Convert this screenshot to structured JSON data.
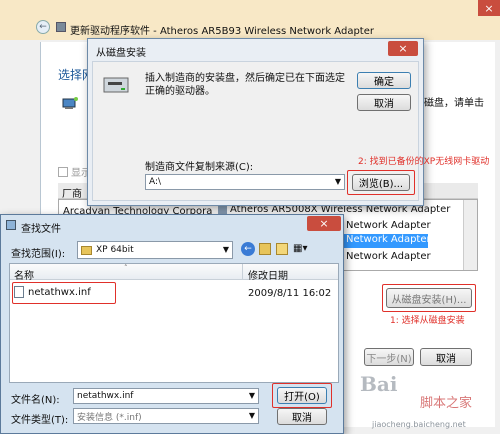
{
  "back_window": {
    "title": "更新驱动程序软件 - Atheros AR5B93 Wireless Network Adapter",
    "heading": "选择网",
    "hint_text": "磁盘，请单击",
    "show_compat": "显示",
    "column_manufacturer": "厂商",
    "manufacturers": [
      "Arcadyan Technology Corpora"
    ],
    "models": [
      {
        "label": "Atheros AR5008X Wireless Network Adapter",
        "selected": false
      },
      {
        "label": "Network Adapter",
        "selected": false
      },
      {
        "label": "Network Adapter",
        "selected": true
      },
      {
        "label": "Network Adapter",
        "selected": false
      }
    ],
    "have_disk_button": "从磁盘安装(H)...",
    "next_button": "下一步(N)",
    "cancel_button": "取消"
  },
  "disk_dialog": {
    "title": "从磁盘安装",
    "message": "插入制造商的安装盘，然后确定已在下面选定正确的驱动器。",
    "ok_button": "确定",
    "cancel_button": "取消",
    "copy_from_label": "制造商文件复制来源(C):",
    "copy_from_value": "A:\\",
    "browse_button": "浏览(B)..."
  },
  "open_dialog": {
    "title": "查找文件",
    "lookin_label": "查找范围(I):",
    "lookin_value": "XP 64bit",
    "col_name": "名称",
    "col_modified": "修改日期",
    "files": [
      {
        "name": "netathwx.inf",
        "modified": "2009/8/11 16:02"
      }
    ],
    "filename_label": "文件名(N):",
    "filename_value": "netathwx.inf",
    "filetype_label": "文件类型(T):",
    "filetype_value": "安装信息 (*.inf)",
    "open_button": "打开(O)",
    "cancel_button": "取消"
  },
  "annotations": {
    "step1": "1: 选择从磁盘安装",
    "step2": "2: 找到已备份的XP无线网卡驱动"
  },
  "watermark": {
    "text1": "Bai",
    "text2": "脚本之家",
    "text3": "jiaocheng.baicheng.net"
  },
  "colors": {
    "accent": "#3399ff",
    "annotation": "#e0302a"
  }
}
